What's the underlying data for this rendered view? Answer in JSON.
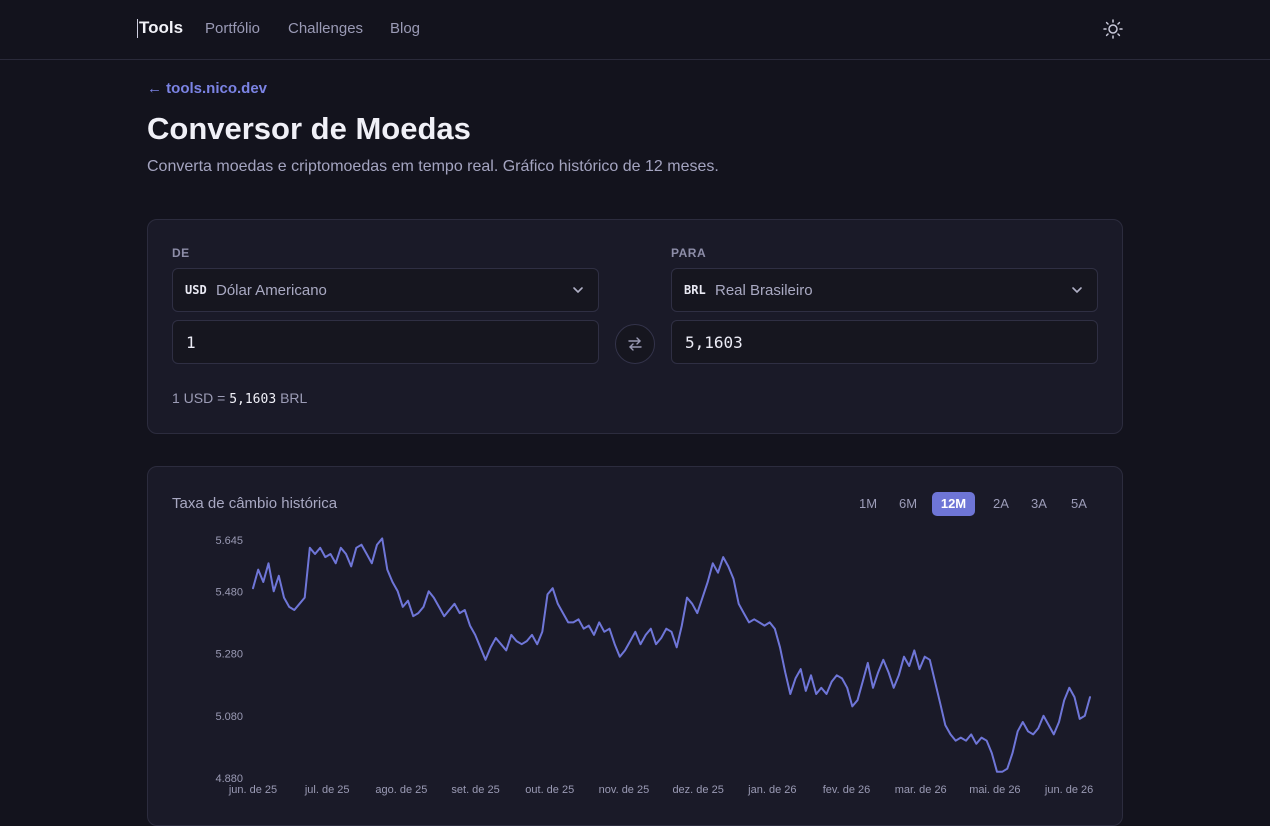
{
  "nav": {
    "brand": "Tools",
    "links": [
      "Portfólio",
      "Challenges",
      "Blog"
    ],
    "theme_icon": "sun-icon"
  },
  "header": {
    "back_link": "← tools.nico.dev",
    "title": "Conversor de Moedas",
    "subtitle": "Converta moedas e criptomoedas em tempo real. Gráfico histórico de 12 meses."
  },
  "converter": {
    "from": {
      "label": "DE",
      "code": "USD",
      "name": "Dólar Americano",
      "amount": "1"
    },
    "to": {
      "label": "PARA",
      "code": "BRL",
      "name": "Real Brasileiro",
      "amount": "5,1603"
    },
    "swap_icon": "swap-arrows-icon",
    "rate": {
      "prefix": "1 USD =",
      "value": "5,1603",
      "suffix": "BRL"
    }
  },
  "chart_section": {
    "title": "Taxa de câmbio histórica",
    "ranges": [
      "1M",
      "6M",
      "12M",
      "2A",
      "3A",
      "5A"
    ],
    "active_range": "12M"
  },
  "colors": {
    "accent": "#6e75d6",
    "line": "#6f76d8",
    "background": "#13131d",
    "card": "#1a1a28"
  },
  "chart_data": {
    "type": "line",
    "title": "Taxa de câmbio histórica",
    "xlabel": "",
    "ylabel": "",
    "ylim": [
      4.88,
      5.645
    ],
    "yticks": [
      "5.645",
      "5.480",
      "5.280",
      "5.080",
      "4.880"
    ],
    "xticks": [
      "jun. de 25",
      "jul. de 25",
      "ago. de 25",
      "set. de 25",
      "out. de 25",
      "nov. de 25",
      "dez. de 25",
      "jan. de 26",
      "fev. de 26",
      "mar. de 26",
      "mai. de 26",
      "jun. de 26"
    ],
    "grid": false,
    "legend": "none",
    "series": [
      {
        "values": [
          5.49,
          5.55,
          5.51,
          5.57,
          5.48,
          5.53,
          5.46,
          5.43,
          5.42,
          5.44,
          5.46,
          5.62,
          5.6,
          5.62,
          5.59,
          5.6,
          5.57,
          5.62,
          5.6,
          5.56,
          5.62,
          5.63,
          5.6,
          5.57,
          5.63,
          5.65,
          5.55,
          5.51,
          5.48,
          5.43,
          5.45,
          5.4,
          5.41,
          5.43,
          5.48,
          5.46,
          5.43,
          5.4,
          5.42,
          5.44,
          5.41,
          5.42,
          5.37,
          5.34,
          5.3,
          5.26,
          5.3,
          5.33,
          5.31,
          5.29,
          5.34,
          5.32,
          5.31,
          5.32,
          5.34,
          5.31,
          5.35,
          5.47,
          5.49,
          5.44,
          5.41,
          5.38,
          5.38,
          5.39,
          5.36,
          5.37,
          5.34,
          5.38,
          5.35,
          5.36,
          5.31,
          5.27,
          5.29,
          5.32,
          5.35,
          5.31,
          5.34,
          5.36,
          5.31,
          5.33,
          5.36,
          5.35,
          5.3,
          5.37,
          5.46,
          5.44,
          5.41,
          5.46,
          5.51,
          5.57,
          5.54,
          5.59,
          5.56,
          5.52,
          5.44,
          5.41,
          5.38,
          5.39,
          5.38,
          5.37,
          5.38,
          5.36,
          5.3,
          5.22,
          5.15,
          5.2,
          5.23,
          5.16,
          5.21,
          5.15,
          5.17,
          5.15,
          5.19,
          5.21,
          5.2,
          5.17,
          5.11,
          5.13,
          5.19,
          5.25,
          5.17,
          5.22,
          5.26,
          5.22,
          5.17,
          5.21,
          5.27,
          5.24,
          5.29,
          5.23,
          5.27,
          5.26,
          5.19,
          5.12,
          5.05,
          5.02,
          5.0,
          5.01,
          5.0,
          5.02,
          4.99,
          5.01,
          5.0,
          4.96,
          4.9,
          4.9,
          4.91,
          4.96,
          5.03,
          5.06,
          5.03,
          5.02,
          5.04,
          5.08,
          5.05,
          5.02,
          5.06,
          5.13,
          5.17,
          5.14,
          5.07,
          5.08,
          5.14
        ]
      }
    ]
  }
}
